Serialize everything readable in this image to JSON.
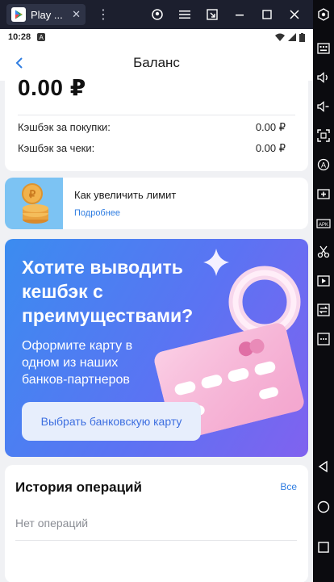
{
  "emulator": {
    "tab_label": "Play ...",
    "tab_close": "✕",
    "kebab": "⋮",
    "controls": [
      "account-icon",
      "menu-icon",
      "screen-icon",
      "minimize-icon",
      "maximize-icon",
      "close-icon"
    ],
    "sidebar_icons": [
      "settings-icon",
      "keyboard-icon",
      "volume-up-icon",
      "volume-down-icon",
      "screenshot-icon",
      "location-icon",
      "add-app-icon",
      "apk-icon",
      "scissors-icon",
      "record-icon",
      "transfer-icon",
      "more-icon",
      "back-nav-icon",
      "home-nav-icon",
      "recent-nav-icon"
    ]
  },
  "status_bar": {
    "time": "10:28",
    "indicator": "A"
  },
  "app_bar": {
    "title": "Баланс"
  },
  "balance": {
    "amount": "0.00 ₽",
    "rows": [
      {
        "label": "Кэшбэк за покупки:",
        "value": "0.00 ₽"
      },
      {
        "label": "Кэшбэк за чеки:",
        "value": "0.00 ₽"
      }
    ]
  },
  "limit": {
    "title": "Как увеличить лимит",
    "link": "Подробнее"
  },
  "promo": {
    "title": "Хотите выводить кешбэк с преимуществами?",
    "subtitle": "Оформите карту в одном из наших банков-партнеров",
    "button": "Выбрать банковскую карту"
  },
  "history": {
    "title": "История операций",
    "all_link": "Все",
    "empty_text": "Нет операций"
  },
  "colors": {
    "accent": "#2f7de1",
    "promo_start": "#3b8cf0",
    "promo_end": "#8062ef",
    "emu_bar": "#1c1f2e"
  }
}
